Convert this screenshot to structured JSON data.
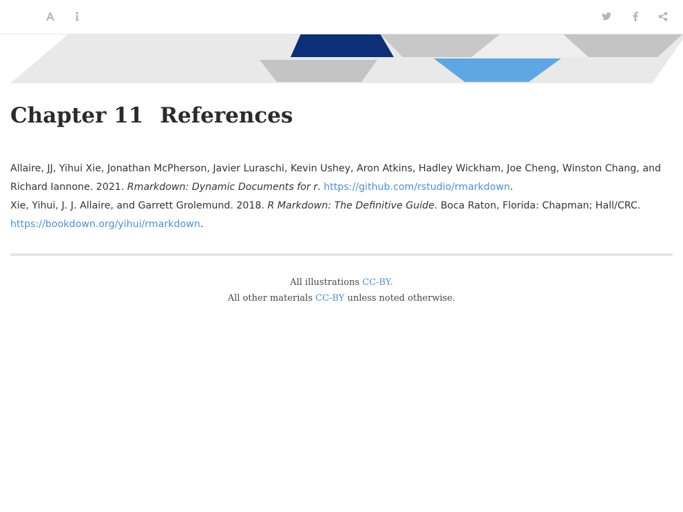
{
  "toolbar": {
    "left_icons": [
      "font-settings-icon",
      "info-icon"
    ],
    "right_icons": [
      "twitter-icon",
      "facebook-icon",
      "share-icon"
    ]
  },
  "chapter": {
    "number": "Chapter 11",
    "title": "References"
  },
  "references": [
    {
      "authors_year": "Allaire, JJ, Yihui Xie, Jonathan McPherson, Javier Luraschi, Kevin Ushey, Aron Atkins, Hadley Wickham, Joe Cheng, Winston Chang, and Richard Iannone. 2021. ",
      "title": "Rmarkdown: Dynamic Documents for r",
      "after_title": ". ",
      "publisher": "",
      "link": "https://github.com/rstudio/rmarkdown",
      "end": "."
    },
    {
      "authors_year": "Xie, Yihui, J. J. Allaire, and Garrett Grolemund. 2018. ",
      "title": "R Markdown: The Definitive Guide",
      "after_title": ". ",
      "publisher": "Boca Raton, Florida: Chapman; Hall/CRC. ",
      "link": "https://bookdown.org/yihui/rmarkdown",
      "end": "."
    }
  ],
  "footer": {
    "line1_prefix": "All illustrations ",
    "line1_link": "CC-BY.",
    "line2_prefix": "All other materials ",
    "line2_link": "CC-BY",
    "line2_suffix": " unless noted otherwise."
  },
  "colors": {
    "link": "#4a90d9",
    "banner_dark_blue": "#0d2f78",
    "banner_light_blue": "#5ea7e4",
    "banner_gray": "#c4c4c4",
    "banner_light_gray": "#e7e7e7"
  }
}
